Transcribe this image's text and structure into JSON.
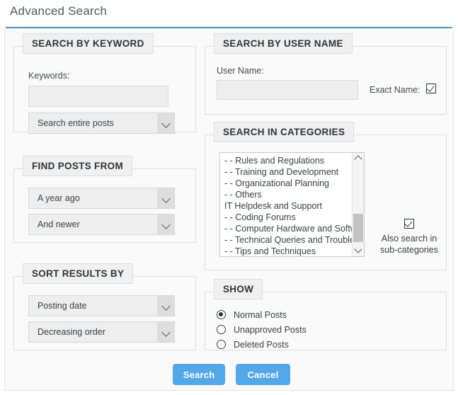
{
  "header": {
    "title": "Advanced Search",
    "rule_color": "#4a90c4"
  },
  "keyword_section": {
    "legend": "SEARCH BY KEYWORD",
    "keywords_label": "Keywords:",
    "keywords_value": "",
    "keywords_placeholder": "",
    "scope_select_value": "Search entire posts"
  },
  "find_posts_section": {
    "legend": "FIND POSTS FROM",
    "from_select_value": "A year ago",
    "direction_select_value": "And newer"
  },
  "sort_section": {
    "legend": "SORT RESULTS BY",
    "sort_by_value": "Posting date",
    "sort_order_value": "Decreasing order"
  },
  "user_section": {
    "legend": "SEARCH BY USER NAME",
    "user_name_label": "User Name:",
    "user_name_value": "",
    "user_name_placeholder": "",
    "exact_name_label": "Exact Name:",
    "exact_name_checked": true
  },
  "categories_section": {
    "legend": "SEARCH IN CATEGORIES",
    "items": [
      "- - Rules and Regulations",
      "- - Training and Development",
      "- - Organizational Planning",
      "- - Others",
      "IT Helpdesk and Support",
      "- - Coding Forums",
      "- - Computer Hardware and Softw",
      "- - Technical Queries and Trouble",
      "- - Tips and Techniques"
    ],
    "subcategories_label_line1": "Also search in",
    "subcategories_label_line2": "sub-categories",
    "subcategories_checked": true,
    "scroll_up_icon": "chevron-up-icon",
    "scroll_down_icon": "chevron-down-icon"
  },
  "show_section": {
    "legend": "SHOW",
    "options": [
      {
        "label": "Normal Posts",
        "selected": true
      },
      {
        "label": "Unapproved Posts",
        "selected": false
      },
      {
        "label": "Deleted Posts",
        "selected": false
      }
    ]
  },
  "actions": {
    "search_label": "Search",
    "cancel_label": "Cancel",
    "button_color": "#52a8e8"
  }
}
